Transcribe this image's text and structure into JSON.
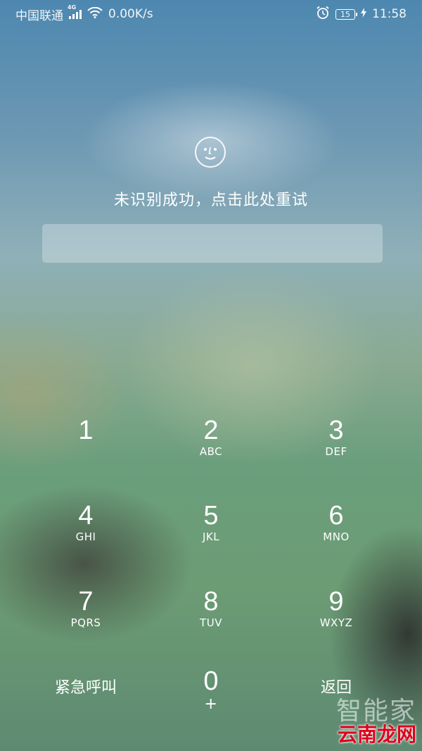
{
  "status_bar": {
    "carrier": "中国联通",
    "network": "4G",
    "speed": "0.00K/s",
    "battery": "15",
    "time": "11:58",
    "icons": [
      "signal-icon",
      "wifi-icon",
      "alarm-icon",
      "battery-icon",
      "charging-icon"
    ]
  },
  "face_unlock": {
    "icon": "face-smile-icon",
    "message": "未识别成功，点击此处重试"
  },
  "password": {
    "value": ""
  },
  "keypad": {
    "keys": [
      {
        "num": "1",
        "letters": ""
      },
      {
        "num": "2",
        "letters": "ABC"
      },
      {
        "num": "3",
        "letters": "DEF"
      },
      {
        "num": "4",
        "letters": "GHI"
      },
      {
        "num": "5",
        "letters": "JKL"
      },
      {
        "num": "6",
        "letters": "MNO"
      },
      {
        "num": "7",
        "letters": "PQRS"
      },
      {
        "num": "8",
        "letters": "TUV"
      },
      {
        "num": "9",
        "letters": "WXYZ"
      },
      {
        "num": "0",
        "letters": "+"
      }
    ],
    "emergency_label": "紧急呼叫",
    "back_label": "返回"
  },
  "watermark": {
    "top": "智能家",
    "bottom": "云南龙网"
  }
}
